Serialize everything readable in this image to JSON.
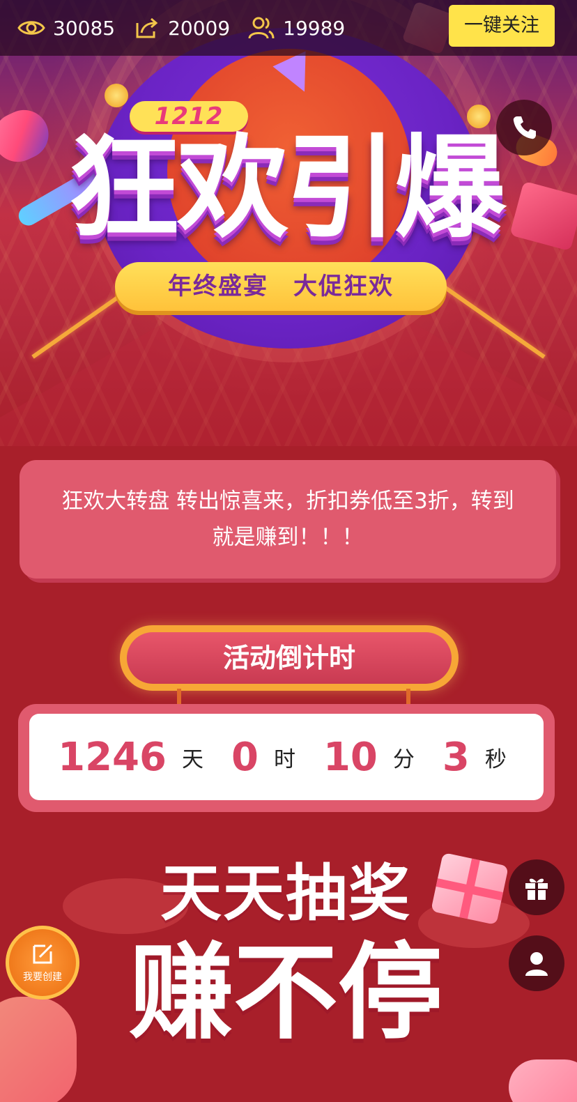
{
  "stats": {
    "views": "30085",
    "shares": "20009",
    "participants": "19989"
  },
  "follow_button": "一键关注",
  "hero": {
    "badge": "1212",
    "title": "狂欢引爆",
    "subtitle": "年终盛宴　大促狂欢"
  },
  "description": "狂欢大转盘 转出惊喜来，折扣券低至3折，转到就是赚到！！！",
  "countdown": {
    "title": "活动倒计时",
    "days": "1246",
    "days_unit": "天",
    "hours": "0",
    "hours_unit": "时",
    "minutes": "10",
    "minutes_unit": "分",
    "seconds": "3",
    "seconds_unit": "秒"
  },
  "banner": {
    "line1": "天天抽奖",
    "line2": "赚不停"
  },
  "create_button": "我要创建",
  "icons": {
    "views": "eye-icon",
    "shares": "share-icon",
    "participants": "users-icon",
    "phone": "phone-icon",
    "gift": "gift-icon",
    "user": "user-icon",
    "create": "edit-icon"
  },
  "colors": {
    "accent_yellow": "#ffe34a",
    "countdown_number": "#d94565",
    "card_pink": "#e05a6e",
    "page_red": "#a81f2a"
  }
}
